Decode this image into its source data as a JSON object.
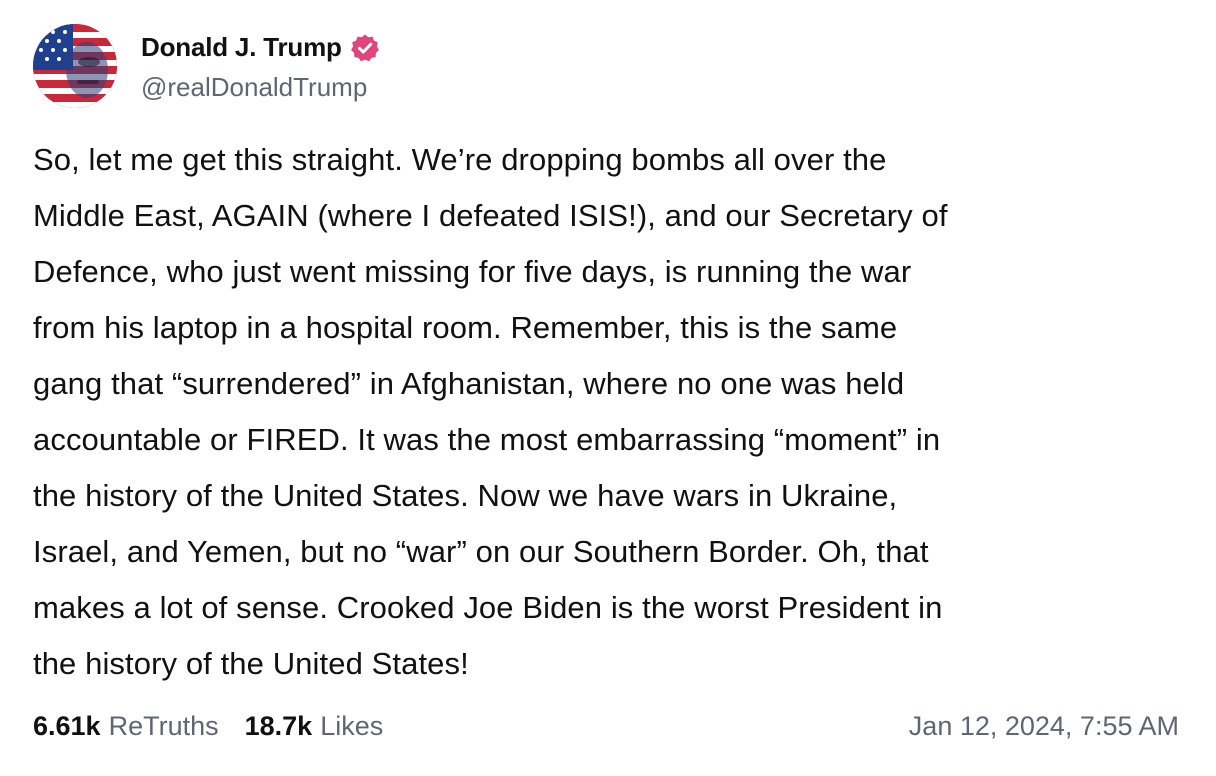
{
  "author": {
    "display_name": "Donald J. Trump",
    "handle": "@realDonaldTrump",
    "avatar_icon": "flag-portrait-avatar",
    "verified_icon": "verified-badge-icon",
    "verified_color": "#e0457b"
  },
  "post": {
    "text": "So, let me get this straight. We’re dropping bombs all over the\nMiddle East, AGAIN (where I defeated ISIS!), and our Secretary of\nDefence, who just went missing for five days, is running the war\nfrom his laptop in a hospital room. Remember, this is the same\ngang that “surrendered” in Afghanistan, where no one was held\naccountable or FIRED. It was the most embarrassing “moment” in\nthe history of the United States. Now we have wars in Ukraine,\nIsrael, and Yemen, but no “war” on our Southern Border. Oh, that\nmakes a lot of sense. Crooked Joe Biden is the worst President in\nthe history of the United States!"
  },
  "stats": {
    "retruths_count": "6.61k",
    "retruths_label": "ReTruths",
    "likes_count": "18.7k",
    "likes_label": "Likes"
  },
  "timestamp": "Jan 12, 2024, 7:55 AM"
}
